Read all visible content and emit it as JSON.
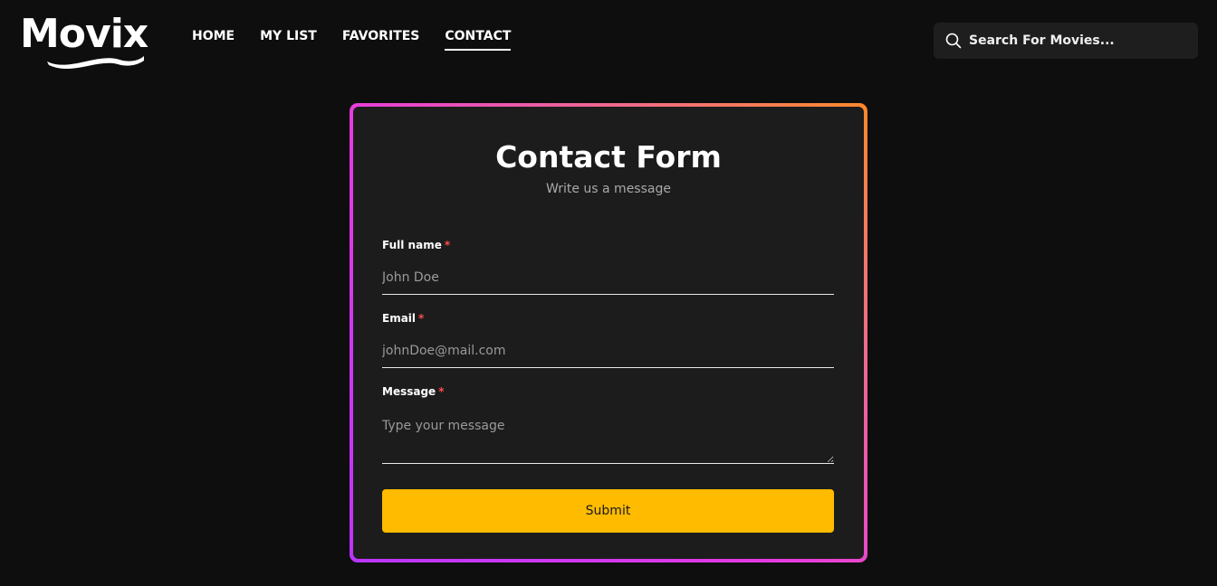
{
  "app": {
    "logo_text": "Movix"
  },
  "nav": {
    "items": [
      {
        "label": "HOME",
        "active": false
      },
      {
        "label": "MY LIST",
        "active": false
      },
      {
        "label": "FAVORITES",
        "active": false
      },
      {
        "label": "CONTACT",
        "active": true
      }
    ]
  },
  "search": {
    "placeholder": "Search For Movies...",
    "icon": "search-icon"
  },
  "form": {
    "title": "Contact Form",
    "subtitle": "Write us a message",
    "required_marker": "*",
    "fields": [
      {
        "label": "Full name",
        "placeholder": "John Doe",
        "value": ""
      },
      {
        "label": "Email",
        "placeholder": "johnDoe@mail.com",
        "value": ""
      },
      {
        "label": "Message",
        "placeholder": "Type your message",
        "value": ""
      }
    ],
    "submit_label": "Submit"
  },
  "colors": {
    "background": "#0e0e0e",
    "card": "#1c1c1c",
    "accent": "#ffbb00",
    "border_gradient_start": "#b935ff",
    "border_gradient_end": "#ff8a2a",
    "required": "#ff4d4d"
  }
}
